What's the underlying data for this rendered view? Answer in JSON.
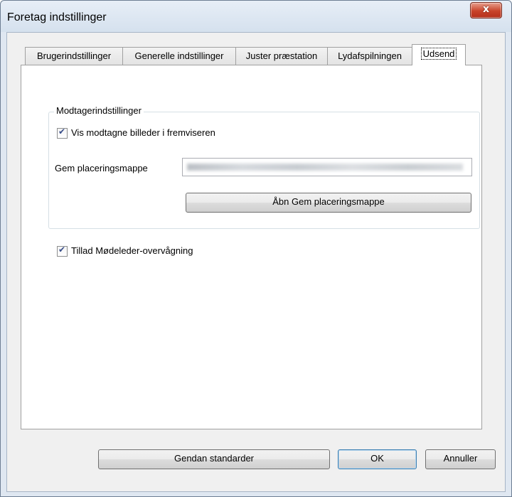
{
  "window": {
    "title": "Foretag indstillinger",
    "close_glyph": "x"
  },
  "tabs": [
    {
      "label": "Brugerindstillinger"
    },
    {
      "label": "Generelle indstillinger"
    },
    {
      "label": "Juster præstation"
    },
    {
      "label": "Lydafspilningen"
    },
    {
      "label": "Udsend",
      "active": true
    }
  ],
  "receiver_group": {
    "title": "Modtagerindstillinger",
    "show_images_label": "Vis modtagne billeder i fremviseren",
    "show_images_checked": true,
    "save_folder_label": "Gem placeringsmappe",
    "open_folder_button": "Åbn Gem placeringsmappe"
  },
  "allow_monitoring": {
    "label": "Tillad Mødeleder-overvågning",
    "checked": true
  },
  "footer": {
    "restore_defaults": "Gendan standarder",
    "ok": "OK",
    "cancel": "Annuller"
  },
  "icons": {
    "checkmark": "check-icon",
    "close": "close-icon"
  },
  "colors": {
    "title_bg": "#dfe7f1",
    "close_button": "#c8432a",
    "panel_bg": "#ffffff",
    "dialog_bg": "#f0f0f0"
  }
}
